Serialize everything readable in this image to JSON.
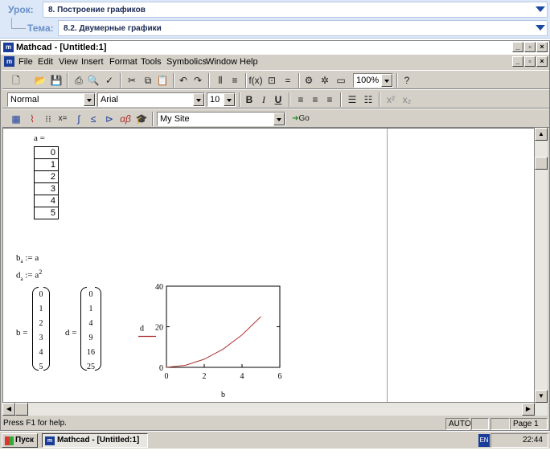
{
  "lesson": {
    "lesson_label": "Урок:",
    "lesson_value": "8. Построение графиков",
    "topic_label": "Тема:",
    "topic_value": "8.2. Двумерные графики"
  },
  "window": {
    "title": "Mathcad - [Untitled:1]",
    "icon_text": "m"
  },
  "menu": [
    "File",
    "Edit",
    "View",
    "Insert",
    "Format",
    "Tools",
    "Symbolics",
    "Window",
    "Help"
  ],
  "toolbar": {
    "zoom": "100%",
    "style": "Normal",
    "font": "Arial",
    "size": "10",
    "bold": "B",
    "italic": "I",
    "underline": "U",
    "site": "My Site",
    "go": "Go"
  },
  "worksheet": {
    "a_label": "a =",
    "a_values": [
      "0",
      "1",
      "2",
      "3",
      "4",
      "5"
    ],
    "b_def": "b",
    "b_sub": "a",
    "b_rhs": ":= a",
    "d_def": "d",
    "d_sub": "a",
    "d_rhs": ":= a",
    "d_exp": "2",
    "b_eq": "b =",
    "b_values": [
      "0",
      "1",
      "2",
      "3",
      "4",
      "5"
    ],
    "d_eq": "d =",
    "d_values": [
      "0",
      "1",
      "4",
      "9",
      "16",
      "25"
    ]
  },
  "chart_data": {
    "type": "line",
    "x": [
      0,
      1,
      2,
      3,
      4,
      5
    ],
    "series": [
      {
        "name": "d",
        "values": [
          0,
          1,
          4,
          9,
          16,
          25
        ],
        "color": "#b03030"
      }
    ],
    "xlabel": "b",
    "ylabel": "d",
    "xlim": [
      0,
      6
    ],
    "ylim": [
      0,
      40
    ],
    "xticks": [
      "0",
      "2",
      "4",
      "6"
    ],
    "yticks": [
      "0",
      "20",
      "40"
    ]
  },
  "status": {
    "help": "Press F1 for help.",
    "mode": "AUTO",
    "page": "Page 1"
  },
  "taskbar": {
    "start": "Пуск",
    "task": "Mathcad - [Untitled:1]",
    "lang": "EN",
    "clock": "22:44"
  }
}
